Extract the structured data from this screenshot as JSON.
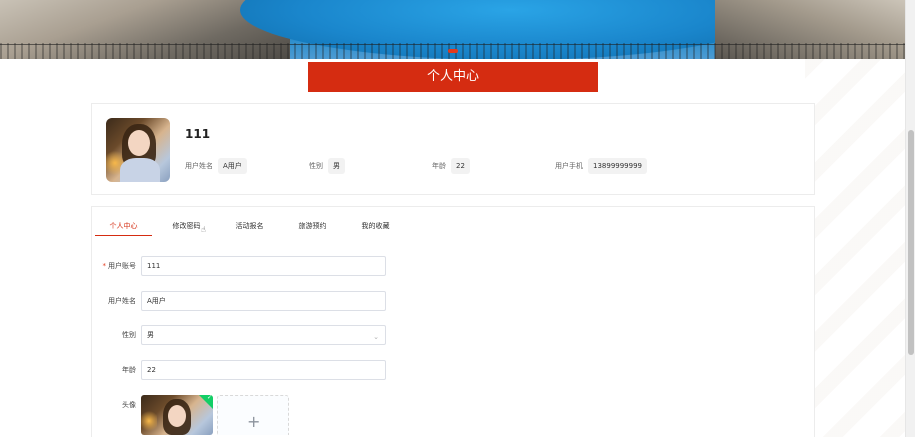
{
  "title_bar": {
    "label": "个人中心"
  },
  "profile": {
    "name": "111",
    "fields": [
      {
        "label": "用户姓名",
        "value": "A用户"
      },
      {
        "label": "性别",
        "value": "男"
      },
      {
        "label": "年龄",
        "value": "22"
      },
      {
        "label": "用户手机",
        "value": "13899999999"
      }
    ]
  },
  "tabs": [
    {
      "label": "个人中心",
      "active": true
    },
    {
      "label": "修改密码",
      "active": false
    },
    {
      "label": "活动报名",
      "active": false
    },
    {
      "label": "旅游预约",
      "active": false
    },
    {
      "label": "我的收藏",
      "active": false
    }
  ],
  "form": {
    "account": {
      "label": "用户账号",
      "value": "111",
      "required_mark": "*"
    },
    "name": {
      "label": "用户姓名",
      "value": "A用户"
    },
    "gender": {
      "label": "性别",
      "value": "男",
      "icon": "chevron-down-icon"
    },
    "age": {
      "label": "年龄",
      "value": "22"
    },
    "avatar": {
      "label": "头像",
      "add_symbol": "+"
    }
  },
  "colors": {
    "accent": "#d52c11",
    "success": "#13ce66"
  }
}
